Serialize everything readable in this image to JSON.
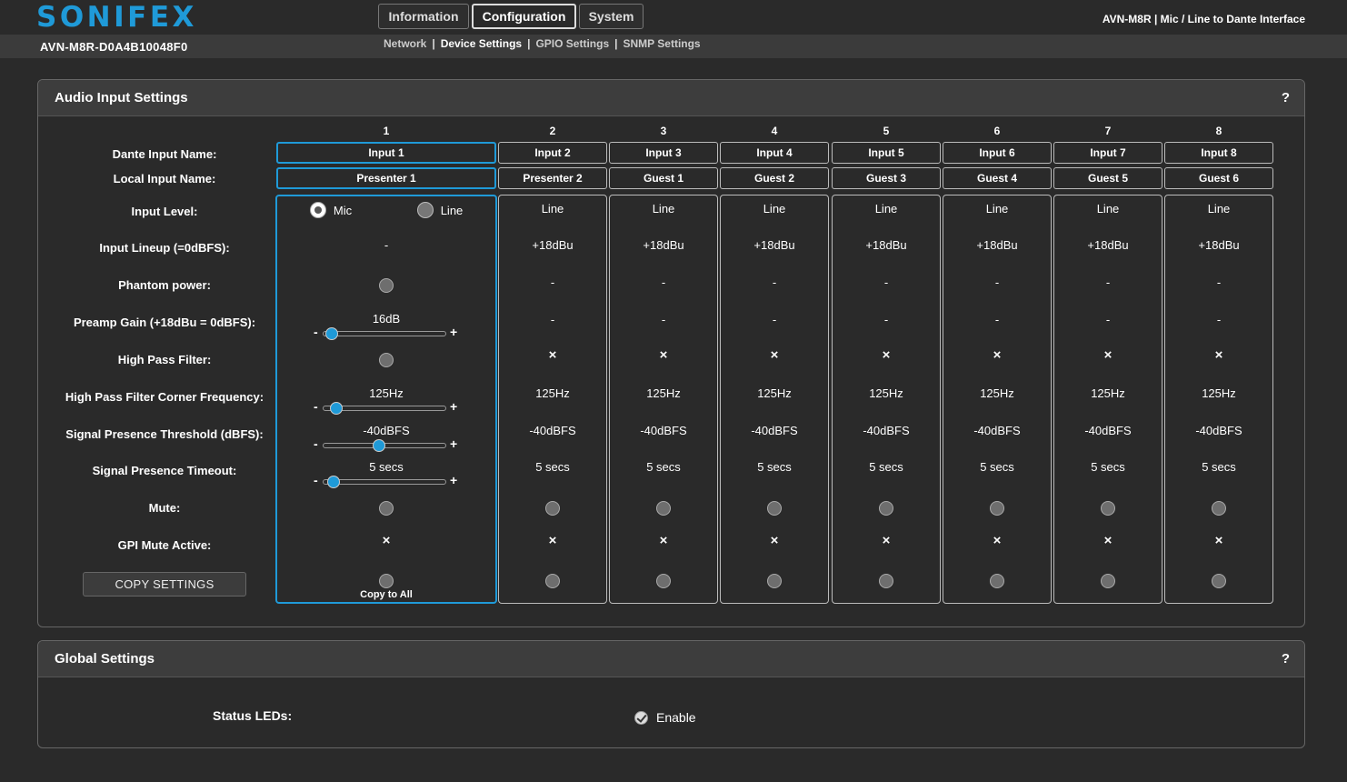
{
  "header": {
    "logo": "SONIFEX",
    "tabs": [
      {
        "label": "Information",
        "active": false
      },
      {
        "label": "Configuration",
        "active": true
      },
      {
        "label": "System",
        "active": false
      }
    ],
    "model": "AVN-M8R | Mic / Line to Dante Interface"
  },
  "subheader": {
    "device_name": "AVN-M8R-D0A4B10048F0",
    "nav": [
      {
        "label": "Network",
        "current": false
      },
      {
        "label": "Device Settings",
        "current": true
      },
      {
        "label": "GPIO Settings",
        "current": false
      },
      {
        "label": "SNMP Settings",
        "current": false
      }
    ]
  },
  "audio_input": {
    "title": "Audio Input Settings",
    "help": "?",
    "row_labels": {
      "dante_name": "Dante Input Name:",
      "local_name": "Local Input Name:",
      "input_level": "Input Level:",
      "lineup": "Input Lineup (=0dBFS):",
      "phantom": "Phantom power:",
      "gain": "Preamp Gain (+18dBu = 0dBFS):",
      "hpf": "High Pass Filter:",
      "hpf_freq": "High Pass Filter Corner Frequency:",
      "threshold": "Signal Presence Threshold (dBFS):",
      "timeout": "Signal Presence Timeout:",
      "mute": "Mute:",
      "gpi_mute": "GPI Mute Active:"
    },
    "copy_button": "COPY SETTINGS",
    "copy_to_all": "Copy to All",
    "channel1": {
      "number": "1",
      "dante_name": "Input 1",
      "local_name": "Presenter 1",
      "mic_label": "Mic",
      "line_label": "Line",
      "selected_level": "Mic",
      "lineup": "-",
      "gain": {
        "label": "16dB",
        "fraction": 0.04
      },
      "hpf_freq": {
        "label": "125Hz",
        "fraction": 0.07
      },
      "threshold": {
        "label": "-40dBFS",
        "fraction": 0.42
      },
      "timeout": {
        "label": "5 secs",
        "fraction": 0.05
      },
      "slider_minus": "-",
      "slider_plus": "+",
      "gpi_mute": "×"
    },
    "channels": [
      {
        "number": "2",
        "dante_name": "Input 2",
        "local_name": "Presenter 2",
        "level": "Line",
        "lineup": "+18dBu",
        "phantom": "-",
        "gain": "-",
        "hpf": "×",
        "hpf_freq": "125Hz",
        "threshold": "-40dBFS",
        "timeout": "5 secs",
        "gpi_mute": "×"
      },
      {
        "number": "3",
        "dante_name": "Input 3",
        "local_name": "Guest 1",
        "level": "Line",
        "lineup": "+18dBu",
        "phantom": "-",
        "gain": "-",
        "hpf": "×",
        "hpf_freq": "125Hz",
        "threshold": "-40dBFS",
        "timeout": "5 secs",
        "gpi_mute": "×"
      },
      {
        "number": "4",
        "dante_name": "Input 4",
        "local_name": "Guest 2",
        "level": "Line",
        "lineup": "+18dBu",
        "phantom": "-",
        "gain": "-",
        "hpf": "×",
        "hpf_freq": "125Hz",
        "threshold": "-40dBFS",
        "timeout": "5 secs",
        "gpi_mute": "×"
      },
      {
        "number": "5",
        "dante_name": "Input 5",
        "local_name": "Guest 3",
        "level": "Line",
        "lineup": "+18dBu",
        "phantom": "-",
        "gain": "-",
        "hpf": "×",
        "hpf_freq": "125Hz",
        "threshold": "-40dBFS",
        "timeout": "5 secs",
        "gpi_mute": "×"
      },
      {
        "number": "6",
        "dante_name": "Input 6",
        "local_name": "Guest 4",
        "level": "Line",
        "lineup": "+18dBu",
        "phantom": "-",
        "gain": "-",
        "hpf": "×",
        "hpf_freq": "125Hz",
        "threshold": "-40dBFS",
        "timeout": "5 secs",
        "gpi_mute": "×"
      },
      {
        "number": "7",
        "dante_name": "Input 7",
        "local_name": "Guest 5",
        "level": "Line",
        "lineup": "+18dBu",
        "phantom": "-",
        "gain": "-",
        "hpf": "×",
        "hpf_freq": "125Hz",
        "threshold": "-40dBFS",
        "timeout": "5 secs",
        "gpi_mute": "×"
      },
      {
        "number": "8",
        "dante_name": "Input 8",
        "local_name": "Guest 6",
        "level": "Line",
        "lineup": "+18dBu",
        "phantom": "-",
        "gain": "-",
        "hpf": "×",
        "hpf_freq": "125Hz",
        "threshold": "-40dBFS",
        "timeout": "5 secs",
        "gpi_mute": "×"
      }
    ]
  },
  "global": {
    "title": "Global Settings",
    "help": "?",
    "status_leds_label": "Status LEDs:",
    "status_leds_option": "Enable",
    "status_leds_checked": true
  },
  "colors": {
    "accent": "#1f9ad8",
    "background": "#2a2a2a"
  }
}
